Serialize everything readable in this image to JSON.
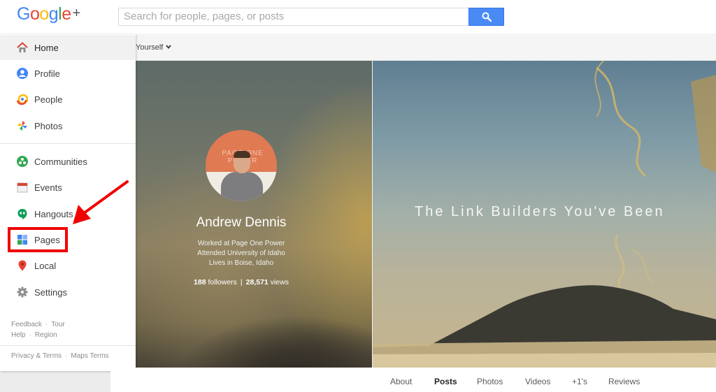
{
  "header": {
    "logo_text": "Google",
    "logo_plus": "+",
    "search_placeholder": "Search for people, pages, or posts",
    "view_as": "Yourself"
  },
  "sidebar": {
    "items": [
      {
        "label": "Home",
        "icon": "home-icon"
      },
      {
        "label": "Profile",
        "icon": "profile-icon"
      },
      {
        "label": "People",
        "icon": "people-icon"
      },
      {
        "label": "Photos",
        "icon": "photos-icon"
      },
      {
        "label": "Communities",
        "icon": "communities-icon"
      },
      {
        "label": "Events",
        "icon": "events-icon"
      },
      {
        "label": "Hangouts",
        "icon": "hangouts-icon"
      },
      {
        "label": "Pages",
        "icon": "pages-icon"
      },
      {
        "label": "Local",
        "icon": "local-icon"
      },
      {
        "label": "Settings",
        "icon": "settings-icon"
      }
    ],
    "footer": {
      "feedback": "Feedback",
      "tour": "Tour",
      "help": "Help",
      "region": "Region",
      "privacy_terms": "Privacy & Terms",
      "maps_terms": "Maps Terms"
    }
  },
  "profile": {
    "name": "Andrew Dennis",
    "work": "Worked at Page One Power",
    "education": "Attended University of Idaho",
    "location": "Lives in Boise, Idaho",
    "followers_count": "188",
    "followers_label": "followers",
    "separator": "|",
    "views_count": "28,571",
    "views_label": "views",
    "avatar_watermark": "PAGE ONE POWER"
  },
  "cover": {
    "title": "The Link Builders You've Been"
  },
  "tabs": [
    "About",
    "Posts",
    "Photos",
    "Videos",
    "+1's",
    "Reviews"
  ],
  "active_tab": "Posts",
  "colors": {
    "google_blue": "#4285f4",
    "google_red": "#ea4335",
    "google_yellow": "#fbbc05",
    "google_green": "#34a853",
    "highlight_red": "#f00000"
  }
}
